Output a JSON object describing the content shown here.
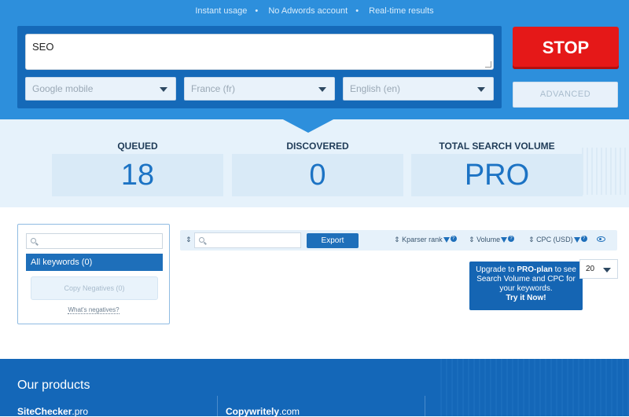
{
  "hero": {
    "tagline": [
      "Instant usage",
      "No Adwords account",
      "Real-time results"
    ],
    "keyword_input": "SEO",
    "selects": {
      "search_engine": "Google mobile",
      "country": "France (fr)",
      "language": "English (en)"
    },
    "stop_label": "STOP",
    "advanced_label": "ADVANCED"
  },
  "stats": {
    "queued_label": "QUEUED",
    "queued_value": "18",
    "discovered_label": "DISCOVERED",
    "discovered_value": "0",
    "volume_label": "TOTAL SEARCH VOLUME",
    "volume_value": "PRO"
  },
  "sidebar": {
    "search_placeholder": "",
    "all_keywords_label": "All keywords (0)",
    "copy_negatives_label": "Copy Negatives (0)",
    "whats_negatives_label": "What's negatives?"
  },
  "toolbar": {
    "sort_glyph": "⇕",
    "search_placeholder": "",
    "export_label": "Export",
    "columns": [
      {
        "label": "Kparser rank"
      },
      {
        "label": "Volume"
      },
      {
        "label": "CPC (USD)"
      }
    ]
  },
  "upgrade": {
    "line1_prefix": "Upgrade to ",
    "line1_bold": "PRO-plan",
    "line1_suffix": " to see Search Volume and CPC for your keywords.",
    "cta": "Try it Now!"
  },
  "pagination": {
    "page_size": "20"
  },
  "footer": {
    "title": "Our products",
    "products": [
      {
        "name": "SiteChecker",
        "tld": ".pro"
      },
      {
        "name": "Copywritely",
        "tld": ".com"
      }
    ]
  },
  "colors": {
    "hero_bg": "#2d8fdc",
    "panel_bg": "#1569b8",
    "stop_red": "#e51818",
    "accent_blue": "#1e6fba",
    "footer_bg": "#1467b8"
  }
}
